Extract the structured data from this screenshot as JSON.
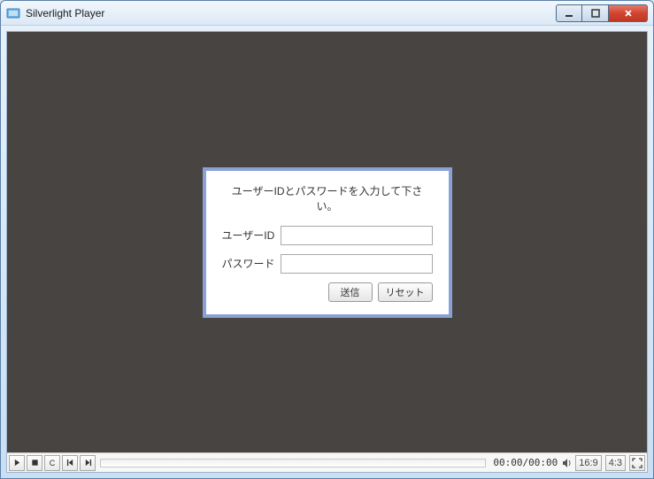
{
  "window": {
    "title": "Silverlight Player"
  },
  "login": {
    "prompt": "ユーザーIDとパスワードを入力して下さい。",
    "userid_label": "ユーザーID",
    "password_label": "パスワード",
    "submit_label": "送信",
    "reset_label": "リセット",
    "userid_value": "",
    "password_value": ""
  },
  "player": {
    "chapter_label": "C",
    "time": "00:00/00:00",
    "aspect_169": "16:9",
    "aspect_43": "4:3"
  }
}
